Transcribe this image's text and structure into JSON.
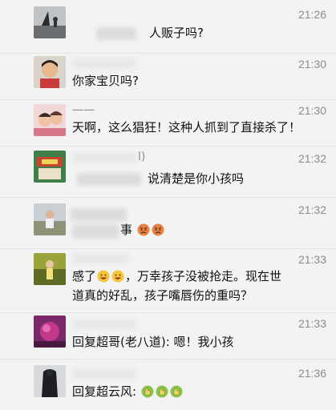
{
  "messages": [
    {
      "time": "21:26",
      "text": "人贩子吗?"
    },
    {
      "time": "21:30",
      "text": "你家宝贝吗?"
    },
    {
      "time": "21:30",
      "name": "一一",
      "text": "天啊，这么猖狂！这种人抓到了直接杀了！"
    },
    {
      "time": "21:32",
      "name": "l)",
      "text": "说清楚是你小孩吗"
    },
    {
      "time": "21:32",
      "text": "事"
    },
    {
      "time": "21:33",
      "text_a": "感了",
      "text_b": "，万幸孩子没被抢走。现在世",
      "text_c": "道真的好乱，孩子嘴唇伤的重吗？"
    },
    {
      "time": "21:33",
      "text": "回复超哥(老八道): 嗯！我小孩"
    },
    {
      "time": "21:36",
      "text": "回复超云风:"
    }
  ],
  "icons": [
    "angry-face-icon",
    "grinning-face-icon",
    "thumbs-up-icon"
  ],
  "colors": {
    "background": "#f3f3f3",
    "time": "#8c8c8c",
    "text": "#111111"
  }
}
